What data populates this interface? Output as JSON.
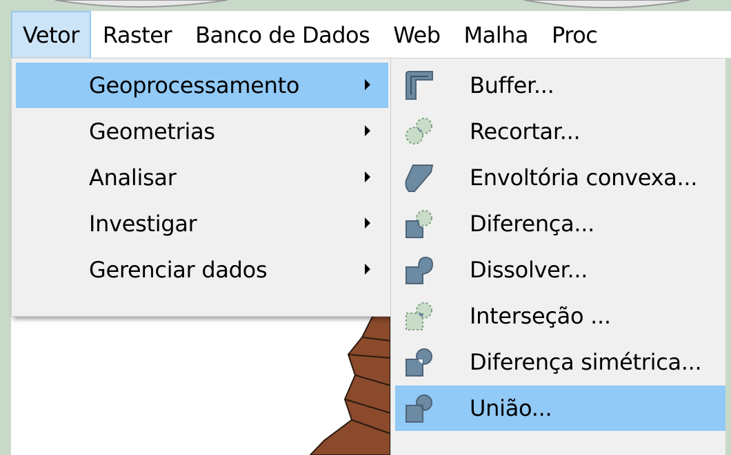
{
  "menubar": {
    "items": [
      "Vetor",
      "Raster",
      "Banco de Dados",
      "Web",
      "Malha",
      "Proc"
    ]
  },
  "vector_menu": {
    "items": [
      {
        "label": "Geoprocessamento",
        "has_submenu": true
      },
      {
        "label": "Geometrias",
        "has_submenu": true
      },
      {
        "label": "Analisar",
        "has_submenu": true
      },
      {
        "label": "Investigar",
        "has_submenu": true
      },
      {
        "label": "Gerenciar dados",
        "has_submenu": true
      }
    ]
  },
  "geoprocessing_submenu": {
    "items": [
      {
        "label": "Buffer...",
        "icon": "buffer-icon"
      },
      {
        "label": "Recortar...",
        "icon": "clip-icon"
      },
      {
        "label": "Envoltória convexa...",
        "icon": "convex-hull-icon"
      },
      {
        "label": "Diferença...",
        "icon": "difference-icon"
      },
      {
        "label": "Dissolver...",
        "icon": "dissolve-icon"
      },
      {
        "label": "Interseção ...",
        "icon": "intersection-icon"
      },
      {
        "label": "Diferença simétrica...",
        "icon": "symmetric-difference-icon"
      },
      {
        "label": "União...",
        "icon": "union-icon"
      }
    ]
  },
  "colors": {
    "menu_bg": "#f0f0f0",
    "highlight": "#91c9f7",
    "menubar_active": "#cce4f7",
    "icon_fill": "#6d8aa3",
    "map_fill": "#8b4a2b"
  }
}
